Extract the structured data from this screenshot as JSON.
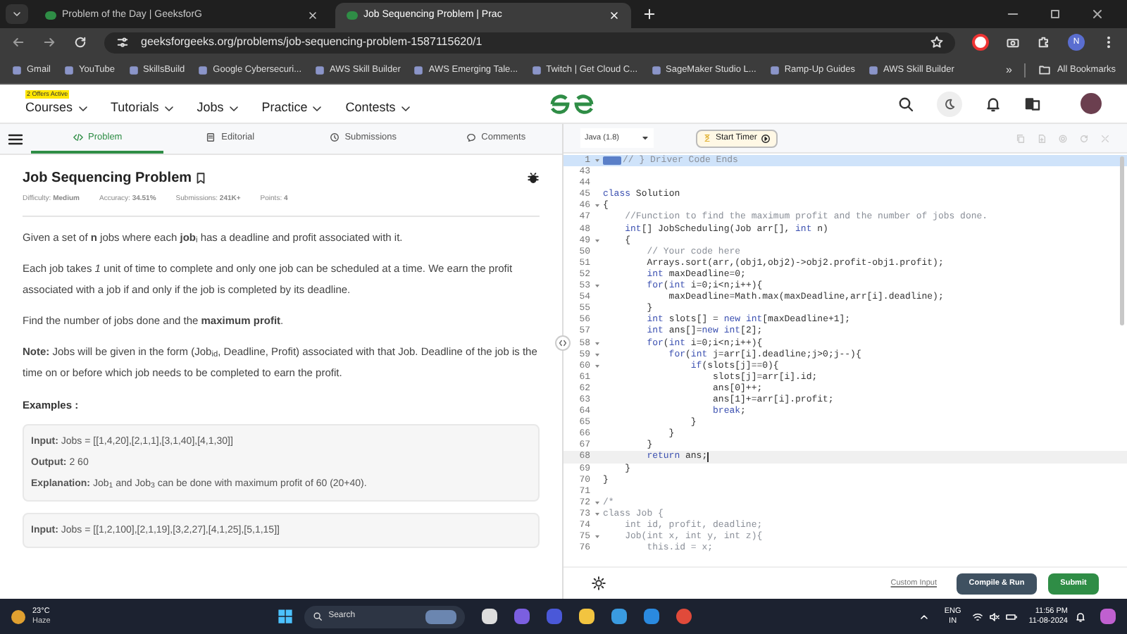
{
  "browser": {
    "tabs": [
      {
        "title": "Problem of the Day | GeeksforG",
        "selected": false
      },
      {
        "title": "Job Sequencing Problem | Prac",
        "selected": true
      }
    ],
    "url": "geeksforgeeks.org/problems/job-sequencing-problem-1587115620/1",
    "profile": "N",
    "bookmarks": [
      "Gmail",
      "YouTube",
      "SkillsBuild",
      "Google Cybersecuri...",
      "AWS Skill Builder",
      "AWS Emerging Tale...",
      "Twitch | Get Cloud C...",
      "SageMaker Studio L...",
      "Ramp-Up Guides",
      "AWS Skill Builder"
    ],
    "more_bookmarks": "»",
    "all_bookmarks": "All Bookmarks"
  },
  "site_nav": {
    "badge": "2 Offers Active",
    "menus": [
      "Courses",
      "Tutorials",
      "Jobs",
      "Practice",
      "Contests"
    ]
  },
  "problem_tabs": [
    {
      "label": "Problem",
      "selected": true
    },
    {
      "label": "Editorial",
      "selected": false
    },
    {
      "label": "Submissions",
      "selected": false
    },
    {
      "label": "Comments",
      "selected": false
    }
  ],
  "problem": {
    "title": "Job Sequencing Problem",
    "meta": [
      "Difficulty: **Medium**",
      "Accuracy: **34.51%**",
      "Submissions: **241K+**",
      "Points: **4**"
    ],
    "paragraphs": [
      "Given a set of **n** jobs where each **job**$_{i}$ has a deadline and profit associated with it.",
      "Each job takes *1* unit of time to complete and only one job can be scheduled at a time. We earn the profit associated with a job if and only if the job is completed by its deadline.",
      "Find the number of jobs done and the **maximum profit**.",
      "**Note:** Jobs will be given in the form (Job$_{id}$, Deadline, Profit) associated with that Job. Deadline of the job is the time on or before which job needs to be completed to earn the profit."
    ],
    "examples_heading": "Examples :",
    "examples": [
      [
        "**Input:** Jobs = [[1,4,20],[2,1,1],[3,1,40],[4,1,30]]",
        "**Output:** 2 60",
        "**Explanation:** Job$_{1}$ and Job$_{3}$ can be done with maximum profit of 60 (20+40)."
      ],
      [
        "**Input:** Jobs = [[1,2,100],[2,1,19],[3,2,27],[4,1,25],[5,1,15]]"
      ]
    ]
  },
  "editor": {
    "language": "Java (1.8)",
    "timer_button": "Start Timer",
    "lines": [
      {
        "number": "1",
        "fold": true,
        "selected": true,
        "current": false,
        "code": [
          {
            "kind": "comment",
            "text": "// } Driver Code Ends"
          }
        ]
      },
      {
        "number": "43",
        "fold": false,
        "selected": false,
        "current": false
      },
      {
        "number": "44",
        "fold": false,
        "selected": false,
        "current": false
      },
      {
        "number": "45",
        "fold": false,
        "selected": false,
        "current": false,
        "code": [
          {
            "kind": "keyword",
            "text": "class"
          },
          {
            "kind": "plain",
            "text": " Solution"
          }
        ]
      },
      {
        "number": "46",
        "fold": true,
        "selected": false,
        "current": false,
        "code": [
          {
            "kind": "plain",
            "text": "{"
          }
        ]
      },
      {
        "number": "47",
        "fold": false,
        "selected": false,
        "current": false,
        "code": [
          {
            "kind": "comment",
            "text": "    //Function to find the maximum profit and the number of jobs done."
          }
        ]
      },
      {
        "number": "48",
        "fold": false,
        "selected": false,
        "current": false,
        "code": [
          {
            "kind": "keyword",
            "text": "    int"
          },
          {
            "kind": "plain",
            "text": "[] JobScheduling(Job arr[], "
          },
          {
            "kind": "keyword",
            "text": "int"
          },
          {
            "kind": "plain",
            "text": " n)"
          }
        ]
      },
      {
        "number": "49",
        "fold": true,
        "selected": false,
        "current": false,
        "code": [
          {
            "kind": "plain",
            "text": "    {"
          }
        ]
      },
      {
        "number": "50",
        "fold": false,
        "selected": false,
        "current": false,
        "code": [
          {
            "kind": "comment",
            "text": "        // Your code here"
          }
        ]
      },
      {
        "number": "51",
        "fold": false,
        "selected": false,
        "current": false,
        "code": [
          {
            "kind": "plain",
            "text": "        Arrays.sort(arr,(obj1,obj2)->obj2.profit-obj1.profit);"
          }
        ]
      },
      {
        "number": "52",
        "fold": false,
        "selected": false,
        "current": false,
        "code": [
          {
            "kind": "keyword",
            "text": "        int"
          },
          {
            "kind": "plain",
            "text": " maxDeadline=0;"
          }
        ]
      },
      {
        "number": "53",
        "fold": true,
        "selected": false,
        "current": false,
        "code": [
          {
            "kind": "keyword",
            "text": "        for"
          },
          {
            "kind": "plain",
            "text": "("
          },
          {
            "kind": "keyword",
            "text": "int"
          },
          {
            "kind": "plain",
            "text": " i=0;i<n;i++){"
          }
        ]
      },
      {
        "number": "54",
        "fold": false,
        "selected": false,
        "current": false,
        "code": [
          {
            "kind": "plain",
            "text": "            maxDeadline=Math.max(maxDeadline,arr[i].deadline);"
          }
        ]
      },
      {
        "number": "55",
        "fold": false,
        "selected": false,
        "current": false,
        "code": [
          {
            "kind": "plain",
            "text": "        }"
          }
        ]
      },
      {
        "number": "56",
        "fold": false,
        "selected": false,
        "current": false,
        "code": [
          {
            "kind": "keyword",
            "text": "        int"
          },
          {
            "kind": "plain",
            "text": " slots[] = "
          },
          {
            "kind": "keyword",
            "text": "new int"
          },
          {
            "kind": "plain",
            "text": "[maxDeadline+1];"
          }
        ]
      },
      {
        "number": "57",
        "fold": false,
        "selected": false,
        "current": false,
        "code": [
          {
            "kind": "keyword",
            "text": "        int"
          },
          {
            "kind": "plain",
            "text": " ans[]="
          },
          {
            "kind": "keyword",
            "text": "new int"
          },
          {
            "kind": "plain",
            "text": "[2];"
          }
        ]
      },
      {
        "number": "58",
        "fold": true,
        "selected": false,
        "current": false,
        "code": [
          {
            "kind": "keyword",
            "text": "        for"
          },
          {
            "kind": "plain",
            "text": "("
          },
          {
            "kind": "keyword",
            "text": "int"
          },
          {
            "kind": "plain",
            "text": " i=0;i<n;i++){"
          }
        ]
      },
      {
        "number": "59",
        "fold": true,
        "selected": false,
        "current": false,
        "code": [
          {
            "kind": "keyword",
            "text": "            for"
          },
          {
            "kind": "plain",
            "text": "("
          },
          {
            "kind": "keyword",
            "text": "int"
          },
          {
            "kind": "plain",
            "text": " j=arr[i].deadline;j>0;j--){"
          }
        ]
      },
      {
        "number": "60",
        "fold": true,
        "selected": false,
        "current": false,
        "code": [
          {
            "kind": "keyword",
            "text": "                if"
          },
          {
            "kind": "plain",
            "text": "(slots[j]==0){"
          }
        ]
      },
      {
        "number": "61",
        "fold": false,
        "selected": false,
        "current": false,
        "code": [
          {
            "kind": "plain",
            "text": "                    slots[j]=arr[i].id;"
          }
        ]
      },
      {
        "number": "62",
        "fold": false,
        "selected": false,
        "current": false,
        "code": [
          {
            "kind": "plain",
            "text": "                    ans[0]++;"
          }
        ]
      },
      {
        "number": "63",
        "fold": false,
        "selected": false,
        "current": false,
        "code": [
          {
            "kind": "plain",
            "text": "                    ans[1]+=arr[i].profit;"
          }
        ]
      },
      {
        "number": "64",
        "fold": false,
        "selected": false,
        "current": false,
        "code": [
          {
            "kind": "keyword",
            "text": "                    break"
          },
          {
            "kind": "plain",
            "text": ";"
          }
        ]
      },
      {
        "number": "65",
        "fold": false,
        "selected": false,
        "current": false,
        "code": [
          {
            "kind": "plain",
            "text": "                }"
          }
        ]
      },
      {
        "number": "66",
        "fold": false,
        "selected": false,
        "current": false,
        "code": [
          {
            "kind": "plain",
            "text": "            }"
          }
        ]
      },
      {
        "number": "67",
        "fold": false,
        "selected": false,
        "current": false,
        "code": [
          {
            "kind": "plain",
            "text": "        }"
          }
        ]
      },
      {
        "number": "68",
        "fold": false,
        "selected": false,
        "current": true,
        "code": [
          {
            "kind": "keyword",
            "text": "        return"
          },
          {
            "kind": "plain",
            "text": " ans;"
          }
        ]
      },
      {
        "number": "69",
        "fold": false,
        "selected": false,
        "current": false,
        "code": [
          {
            "kind": "plain",
            "text": "    }"
          }
        ]
      },
      {
        "number": "70",
        "fold": false,
        "selected": false,
        "current": false,
        "code": [
          {
            "kind": "plain",
            "text": "}"
          }
        ]
      },
      {
        "number": "71",
        "fold": false,
        "selected": false,
        "current": false
      },
      {
        "number": "72",
        "fold": true,
        "selected": false,
        "current": false,
        "code": [
          {
            "kind": "comment",
            "text": "/*"
          }
        ]
      },
      {
        "number": "73",
        "fold": true,
        "selected": false,
        "current": false,
        "code": [
          {
            "kind": "comment",
            "text": "class Job {"
          }
        ]
      },
      {
        "number": "74",
        "fold": false,
        "selected": false,
        "current": false,
        "code": [
          {
            "kind": "comment",
            "text": "    int id, profit, deadline;"
          }
        ]
      },
      {
        "number": "75",
        "fold": true,
        "selected": false,
        "current": false,
        "code": [
          {
            "kind": "comment",
            "text": "    Job(int x, int y, int z){"
          }
        ]
      },
      {
        "number": "76",
        "fold": false,
        "selected": false,
        "current": false,
        "code": [
          {
            "kind": "comment",
            "text": "        this.id = x;"
          }
        ]
      }
    ],
    "custom_input": "Custom Input",
    "buttons": [
      {
        "label": "Compile & Run",
        "kind": "secondary"
      },
      {
        "label": "Submit",
        "kind": "primary"
      }
    ]
  },
  "taskbar": {
    "temperature": "23°C",
    "weather": "Haze",
    "search_placeholder": "Search",
    "language": "ENG",
    "region": "IN",
    "time": "11:56 PM",
    "date": "11-08-2024"
  }
}
